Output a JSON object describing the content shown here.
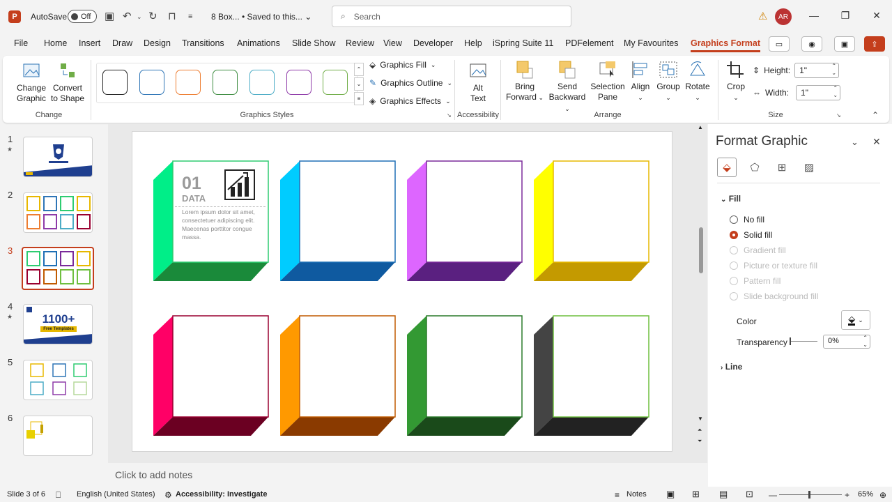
{
  "titlebar": {
    "logo_letter": "P",
    "autosave_label": "AutoSave",
    "autosave_state": "Off",
    "doc_title": "8 Box... • Saved to this...",
    "doc_title_chevron": "⌄",
    "search_placeholder": "Search",
    "avatar_initials": "AR"
  },
  "menu": {
    "tabs": [
      "File",
      "Home",
      "Insert",
      "Draw",
      "Design",
      "Transitions",
      "Animations",
      "Slide Show",
      "Review",
      "View",
      "Developer",
      "Help",
      "iSpring Suite 11",
      "PDFelement",
      "My Favourites",
      "Graphics Format"
    ],
    "active_tab": "Graphics Format"
  },
  "ribbon": {
    "change_graphic": "Change Graphic",
    "convert_to_shape": "Convert to Shape",
    "group_change": "Change",
    "group_graphics_styles": "Graphics Styles",
    "graphics_fill": "Graphics Fill",
    "graphics_outline": "Graphics Outline",
    "graphics_effects": "Graphics Effects",
    "alt_text": "Alt Text",
    "group_accessibility": "Accessibility",
    "bring_forward": "Bring Forward",
    "send_backward": "Send Backward",
    "selection_pane": "Selection Pane",
    "align": "Align",
    "group": "Group",
    "rotate": "Rotate",
    "group_arrange": "Arrange",
    "crop": "Crop",
    "height_label": "Height:",
    "height_value": "1\"",
    "width_label": "Width:",
    "width_value": "1\"",
    "group_size": "Size",
    "style_colors": [
      "#222222",
      "#2e75b6",
      "#ed7d31",
      "#3d8c40",
      "#4bacc6",
      "#8e3aa8",
      "#70ad47"
    ]
  },
  "thumbnails": [
    {
      "num": "1",
      "starred": true
    },
    {
      "num": "2",
      "starred": false
    },
    {
      "num": "3",
      "starred": false,
      "selected": true
    },
    {
      "num": "4",
      "starred": true,
      "headline": "1100+",
      "subline": "Free Templates"
    },
    {
      "num": "5",
      "starred": false
    },
    {
      "num": "6",
      "starred": false
    }
  ],
  "slide": {
    "boxes": [
      {
        "front": "#2ecc71",
        "left": "#00ee88",
        "bottom": "#1a8a3a"
      },
      {
        "front": "#1e6fb5",
        "left": "#00ccff",
        "bottom": "#0f5aa0"
      },
      {
        "front": "#7a2a9a",
        "left": "#dd66ff",
        "bottom": "#5a2080"
      },
      {
        "front": "#e6b800",
        "left": "#ffff00",
        "bottom": "#c49a00"
      },
      {
        "front": "#9a0030",
        "left": "#ff0066",
        "bottom": "#6b0022"
      },
      {
        "front": "#c05a00",
        "left": "#ff9900",
        "bottom": "#8a3a00"
      },
      {
        "front": "#2a7a2a",
        "left": "#339933",
        "bottom": "#1a4a1a"
      },
      {
        "front": "#6fbf3f",
        "left": "#444444",
        "bottom": "#222222"
      }
    ],
    "box1": {
      "number": "01",
      "label": "DATA",
      "body": "Lorem ipsum dolor sit amet, consectetuer adipiscing elit. Maecenas porttitor congue massa."
    },
    "notes_placeholder": "Click to add notes"
  },
  "pane": {
    "title": "Format Graphic",
    "fill_section": "Fill",
    "options": [
      {
        "label": "No fill",
        "checked": false,
        "disabled": false
      },
      {
        "label": "Solid fill",
        "checked": true,
        "disabled": false
      },
      {
        "label": "Gradient fill",
        "checked": false,
        "disabled": true
      },
      {
        "label": "Picture or texture fill",
        "checked": false,
        "disabled": true
      },
      {
        "label": "Pattern fill",
        "checked": false,
        "disabled": true
      },
      {
        "label": "Slide background fill",
        "checked": false,
        "disabled": true
      }
    ],
    "color_label": "Color",
    "transparency_label": "Transparency",
    "transparency_value": "0%",
    "line_section": "Line"
  },
  "status": {
    "slide_info": "Slide 3 of 6",
    "language": "English (United States)",
    "accessibility": "Accessibility: Investigate",
    "notes": "Notes",
    "zoom": "65%"
  }
}
